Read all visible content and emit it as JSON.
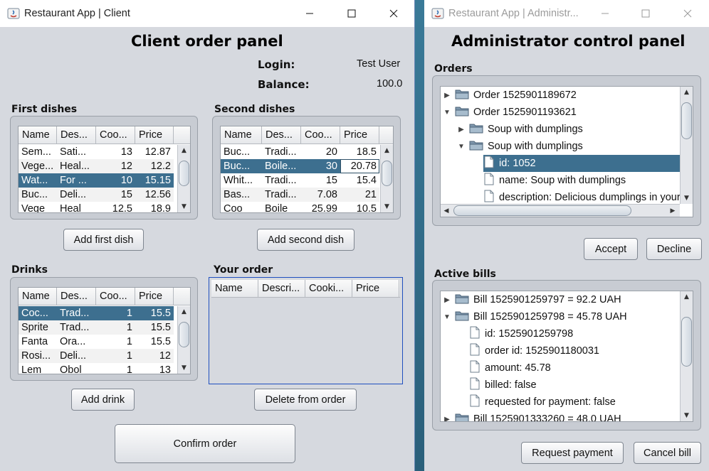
{
  "client": {
    "title": "Restaurant App | Client",
    "heading": "Client order panel",
    "login_label": "Login:",
    "login_value": "Test User",
    "balance_label": "Balance:",
    "balance_value": "100.0",
    "first_dishes": {
      "label": "First dishes",
      "headers": [
        "Name",
        "Des...",
        "Coo...",
        "Price"
      ],
      "rows": [
        [
          "Sem...",
          "Sati...",
          "13",
          "12.87"
        ],
        [
          "Vege...",
          "Heal...",
          "12",
          "12.2"
        ],
        [
          "Wat...",
          "For ...",
          "10",
          "15.15"
        ],
        [
          "Buc...",
          "Deli...",
          "15",
          "12.56"
        ],
        [
          "Vege",
          "Heal",
          "12.5",
          "18.9"
        ]
      ],
      "selected_row": 2,
      "button": "Add first dish"
    },
    "second_dishes": {
      "label": "Second dishes",
      "headers": [
        "Name",
        "Des...",
        "Coo...",
        "Price"
      ],
      "rows": [
        [
          "Buc...",
          "Tradi...",
          "20",
          "18.5"
        ],
        [
          "Buc...",
          "Boile...",
          "30",
          "20.78"
        ],
        [
          "Whit...",
          "Tradi...",
          "15",
          "15.4"
        ],
        [
          "Bas...",
          "Tradi...",
          "7.08",
          "21"
        ],
        [
          "Coo",
          "Boile",
          "25.99",
          "10.5"
        ]
      ],
      "selected_row": 1,
      "button": "Add second dish"
    },
    "drinks": {
      "label": "Drinks",
      "headers": [
        "Name",
        "Des...",
        "Coo...",
        "Price"
      ],
      "rows": [
        [
          "Coc...",
          "Trad...",
          "1",
          "15.5"
        ],
        [
          "Sprite",
          "Trad...",
          "1",
          "15.5"
        ],
        [
          "Fanta",
          "Ora...",
          "1",
          "15.5"
        ],
        [
          "Rosi...",
          "Deli...",
          "1",
          "12"
        ],
        [
          "Lem",
          "Obol",
          "1",
          "13"
        ]
      ],
      "selected_row": 0,
      "button": "Add drink"
    },
    "your_order": {
      "label": "Your order",
      "headers": [
        "Name",
        "Descri...",
        "Cooki...",
        "Price"
      ],
      "button": "Delete from order"
    },
    "confirm_button": "Confirm order"
  },
  "admin": {
    "title": "Restaurant App | Administr...",
    "heading": "Administrator control panel",
    "orders_label": "Orders",
    "orders_tree": [
      {
        "text": "Order 1525901189672",
        "type": "folder",
        "expanded": false
      },
      {
        "text": "Order 1525901193621",
        "type": "folder",
        "expanded": true
      },
      {
        "text": "Soup with dumplings",
        "type": "folder",
        "expanded": false
      },
      {
        "text": "Soup with dumplings",
        "type": "folder",
        "expanded": true
      },
      {
        "text": "id: 1052",
        "type": "leaf",
        "selected": true
      },
      {
        "text": "name: Soup with dumplings",
        "type": "leaf"
      },
      {
        "text": "description: Delicious dumplings in your",
        "type": "leaf"
      }
    ],
    "accept_button": "Accept",
    "decline_button": "Decline",
    "bills_label": "Active bills",
    "bills_tree": [
      {
        "text": "Bill 1525901259797 = 92.2 UAH",
        "type": "folder",
        "expanded": false
      },
      {
        "text": "Bill 1525901259798 = 45.78 UAH",
        "type": "folder",
        "expanded": true
      },
      {
        "text": "id: 1525901259798",
        "type": "leaf"
      },
      {
        "text": "order id: 1525901180031",
        "type": "leaf"
      },
      {
        "text": "amount: 45.78",
        "type": "leaf"
      },
      {
        "text": "billed: false",
        "type": "leaf"
      },
      {
        "text": "requested for payment: false",
        "type": "leaf"
      },
      {
        "text": "Bill 1525901333260 = 48.0 UAH",
        "type": "folder",
        "expanded": false
      }
    ],
    "request_payment_button": "Request payment",
    "cancel_bill_button": "Cancel bill"
  },
  "colors": {
    "selection": "#3d6f8f",
    "window_bg": "#d6d9df"
  }
}
